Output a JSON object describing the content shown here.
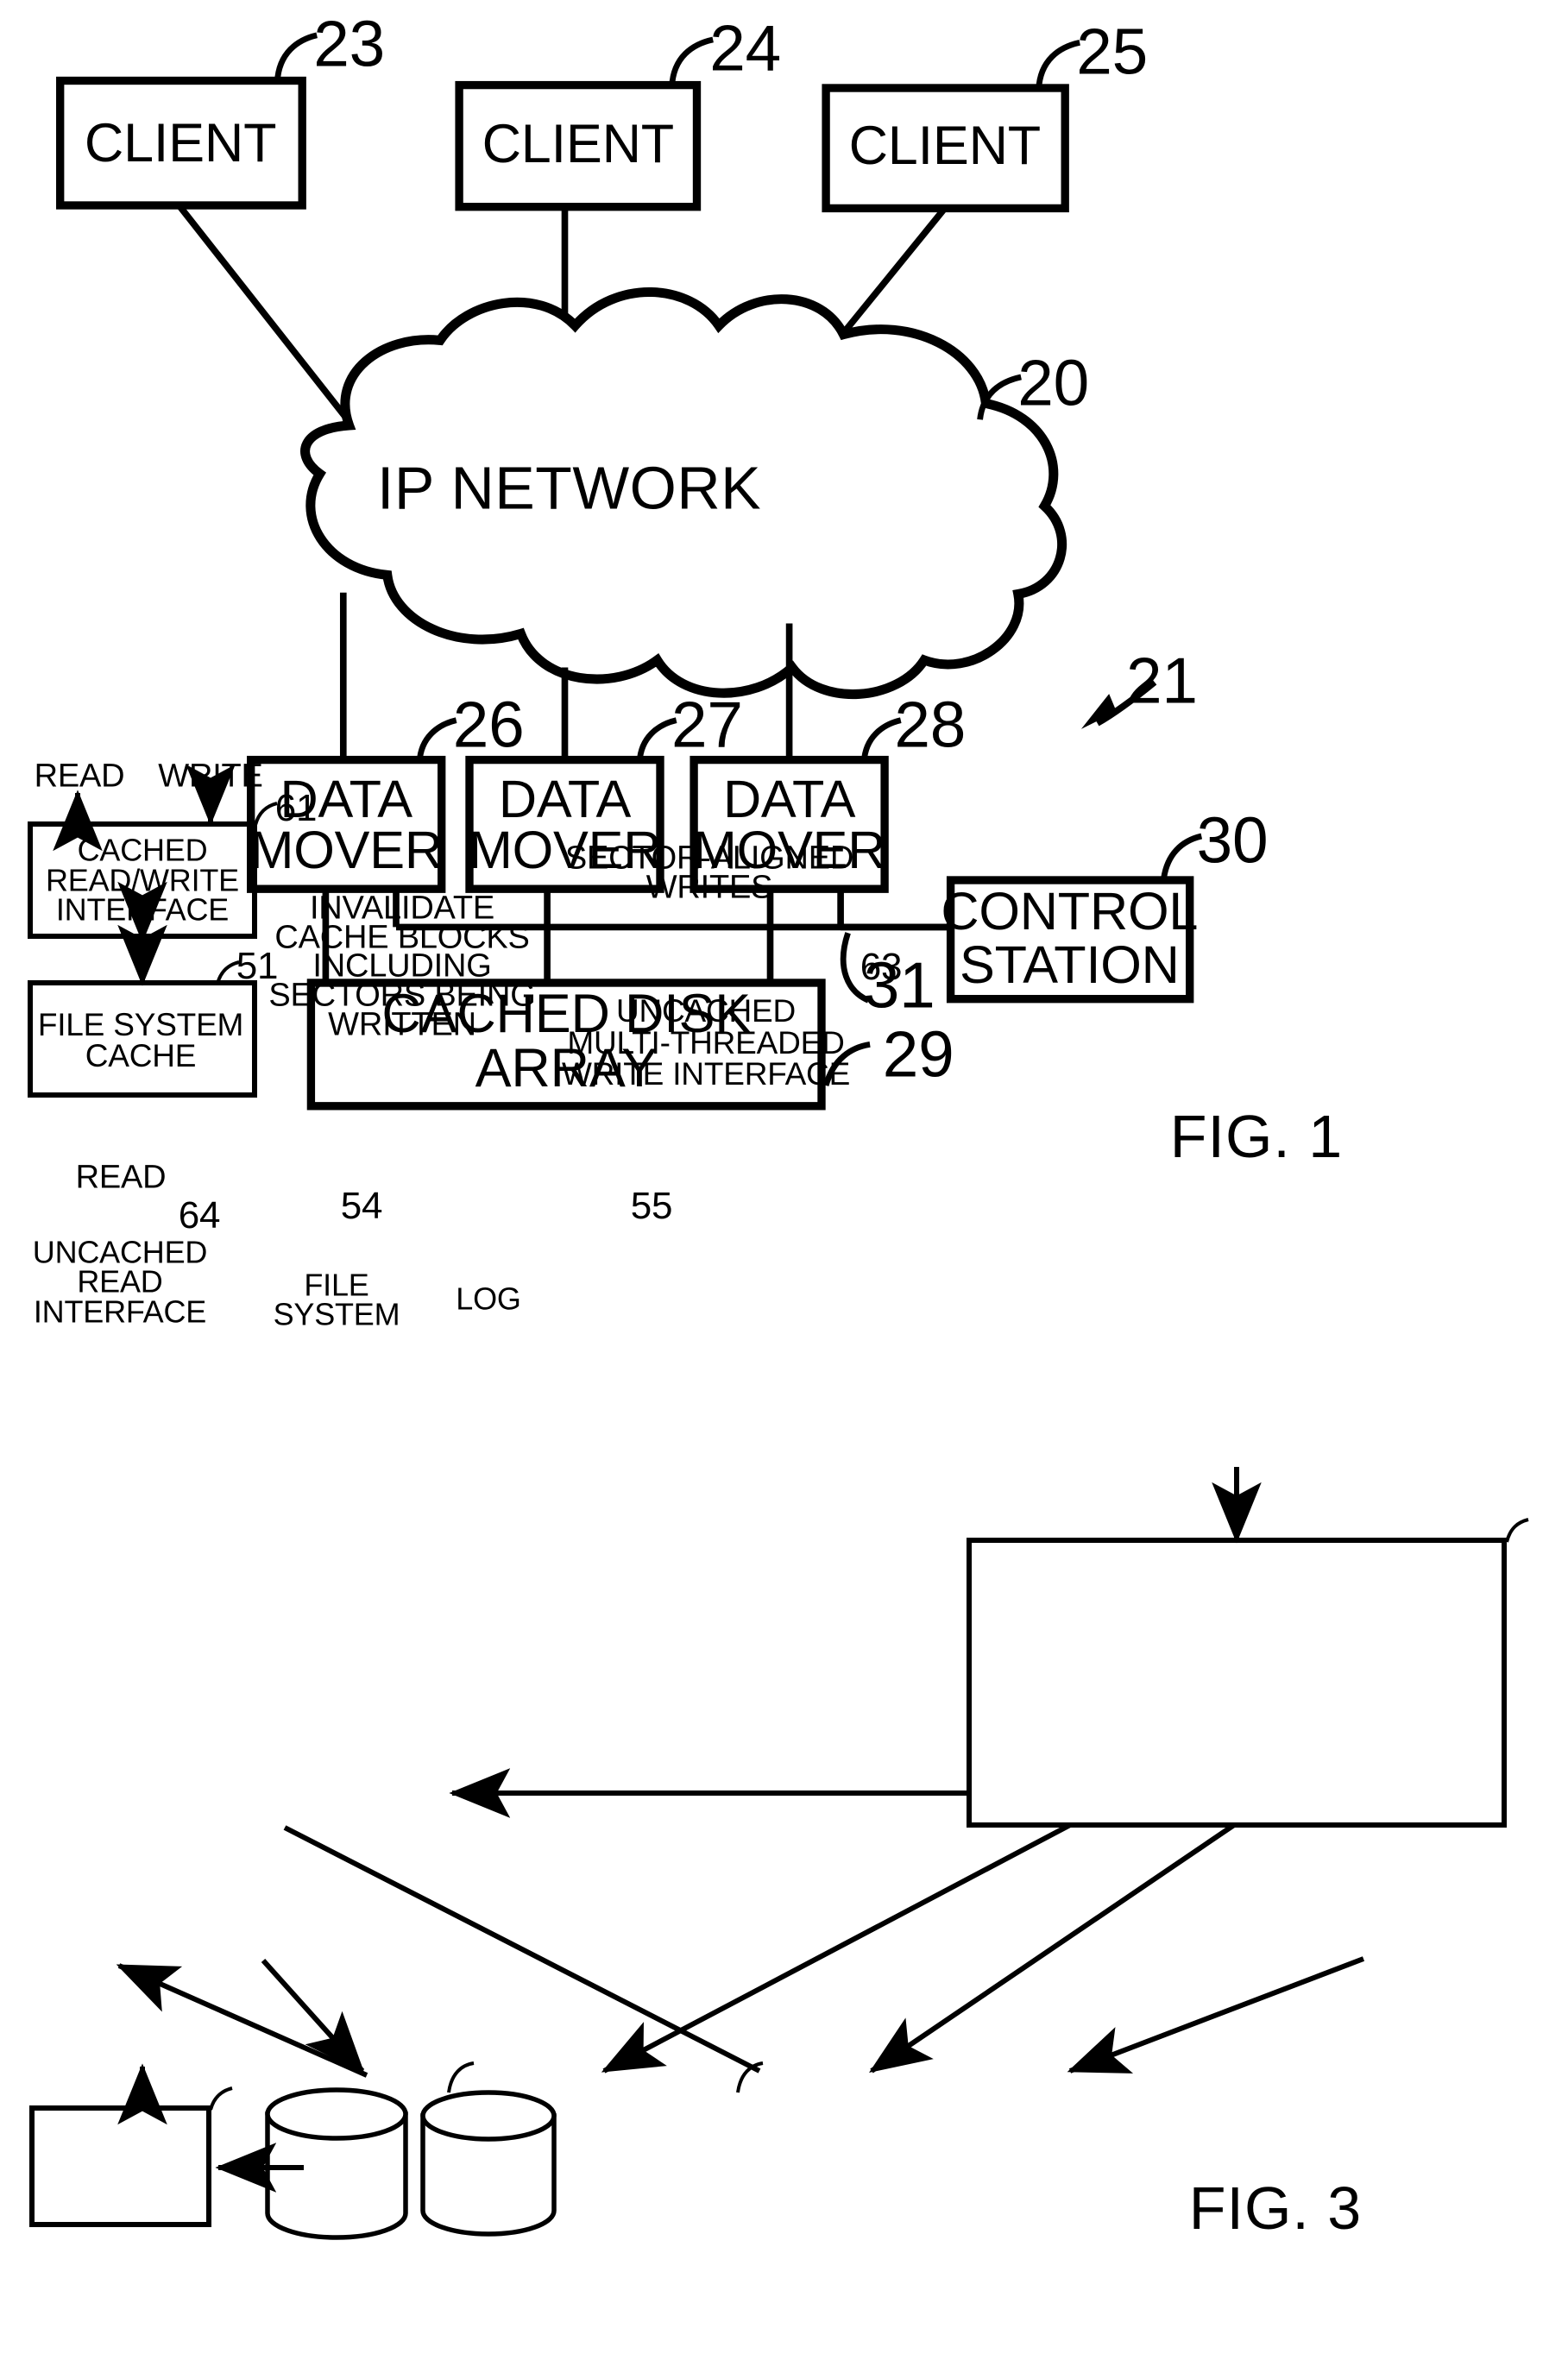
{
  "document": {
    "type": "patent-drawing-sheet",
    "figures": [
      "FIG. 1",
      "FIG. 3"
    ]
  },
  "fig1": {
    "caption": "FIG. 1",
    "system_ref": "21",
    "clients": [
      {
        "label": "CLIENT",
        "ref": "23"
      },
      {
        "label": "CLIENT",
        "ref": "24"
      },
      {
        "label": "CLIENT",
        "ref": "25"
      }
    ],
    "network": {
      "label": "IP NETWORK",
      "ref": "20"
    },
    "data_movers": [
      {
        "label_line1": "DATA",
        "label_line2": "MOVER",
        "ref": "26"
      },
      {
        "label_line1": "DATA",
        "label_line2": "MOVER",
        "ref": "27"
      },
      {
        "label_line1": "DATA",
        "label_line2": "MOVER",
        "ref": "28"
      }
    ],
    "control_station": {
      "label_line1": "CONTROL",
      "label_line2": "STATION",
      "ref": "30"
    },
    "cached_disk_array": {
      "label_line1": "CACHED DISK",
      "label_line2": "ARRAY",
      "ref": "29"
    },
    "bus": {
      "ref": "31"
    }
  },
  "fig3": {
    "caption": "FIG. 3",
    "flows": {
      "read_top": "READ",
      "write_top": "WRITE",
      "sector_aligned_writes_line1": "SECTOR-ALIGNED",
      "sector_aligned_writes_line2": "WRITES",
      "read_bottom": "READ",
      "invalidate_line1": "INVALIDATE",
      "invalidate_line2": "CACHE BLOCKS",
      "invalidate_line3": "INCLUDING",
      "invalidate_line4": "SECTORS BEING",
      "invalidate_line5": "WRITTEN"
    },
    "blocks": {
      "cached_rw_interface": {
        "line1": "CACHED",
        "line2": "READ/WRITE",
        "line3": "INTERFACE",
        "ref": "61"
      },
      "file_system_cache": {
        "line1": "FILE SYSTEM",
        "line2": "CACHE",
        "ref": "51"
      },
      "uncached_write_interface": {
        "line1": "UNCACHED",
        "line2": "MULTI-THREADED",
        "line3": "WRITE INTERFACE",
        "ref": "63"
      },
      "uncached_read_interface": {
        "line1": "UNCACHED",
        "line2": "READ",
        "line3": "INTERFACE",
        "ref": "64"
      }
    },
    "stores": {
      "file_system": {
        "line1": "FILE",
        "line2": "SYSTEM",
        "ref": "54"
      },
      "log": {
        "line1": "LOG",
        "ref": "55"
      }
    }
  },
  "style": {
    "ink": "#000000",
    "paper": "#ffffff"
  }
}
